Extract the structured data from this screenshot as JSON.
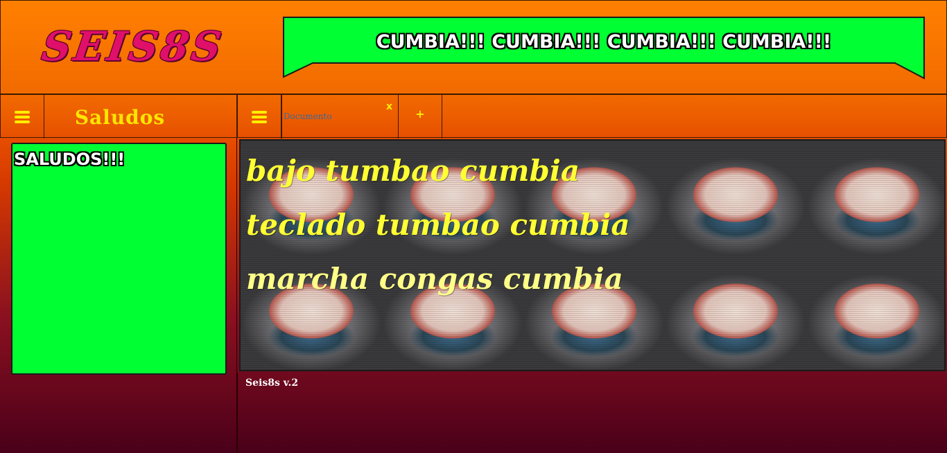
{
  "header": {
    "logo": "SEIS8S",
    "banner": "CUMBIA!!! CUMBIA!!! CUMBIA!!! CUMBIA!!!"
  },
  "left_sidebar": {
    "menu_icon": "hamburger-icon",
    "title": "Saludos",
    "panel_text": "SALUDOS!!!"
  },
  "editor": {
    "menu_icon": "hamburger-icon",
    "tabs": [
      {
        "label": "Documento",
        "close": "x"
      }
    ],
    "add_tab": "+",
    "lines": [
      "bajo tumbao cumbia",
      "teclado tumbao cumbia",
      "marcha congas cumbia"
    ]
  },
  "footer": {
    "version": "Seis8s v.2"
  },
  "colors": {
    "accent_green": "#00ff33",
    "accent_yellow": "#ffe600",
    "logo_pink": "#e0106a",
    "header_orange": "#ff8000"
  }
}
